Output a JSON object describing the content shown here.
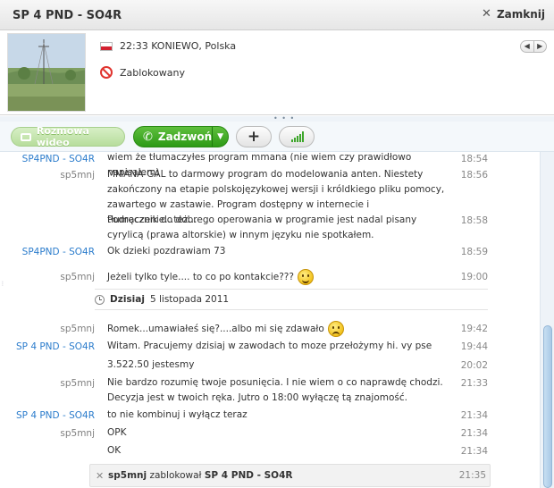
{
  "window": {
    "title": "SP 4 PND - SO4R",
    "close_label": "Zamknij"
  },
  "profile": {
    "local_time_location": "22:33 KONIEWO, Polska",
    "status": "Zablokowany"
  },
  "toolbar": {
    "video_call": "Rozmowa wideo",
    "call": "Zadzwoń"
  },
  "messages": [
    {
      "sender": "",
      "text": "wiem że tłumaczyłes program mmana (nie wiem czy prawidłowo napisałem)",
      "time": ""
    },
    {
      "sender": "SP4PND - SO4R",
      "text": "",
      "time": "18:54"
    },
    {
      "sender": "sp5mnj",
      "text": "MMANA-GAL to darmowy program do modelowania anten. Niestety zakończony na etapie polskojęzykowej wersji i króldkiego pliku pomocy, zawartego w zastawie. Program dostępny w internecie i tłumaczenie...też...",
      "time": "18:56"
    },
    {
      "sender": "",
      "text": "Podręcznik do dobrego operowania w programie jest nadal pisany cyrylicą (prawa altorskie) w innym języku nie spotkałem.",
      "time": "18:58"
    },
    {
      "sender": "SP4PND - SO4R",
      "text": "Ok dzieki pozdrawiam 73",
      "time": "18:59"
    },
    {
      "sender": "sp5mnj",
      "text": "Jeżeli tylko tyle.... to co po kontakcie???",
      "time": "19:00"
    },
    {
      "sender": "sp5mnj",
      "text": "Romek...umawiałeś się?....albo mi się zdawało",
      "time": "19:42"
    },
    {
      "sender": "SP 4 PND - SO4R",
      "text": "Witam. Pracujemy dzisiaj w zawodach to moze przełożymy hi. vy pse",
      "time": "19:44"
    },
    {
      "sender": "",
      "text": "3.522.50 jestesmy",
      "time": "20:02"
    },
    {
      "sender": "sp5mnj",
      "text": "Nie bardzo rozumię twoje posunięcia. I nie wiem o co naprawdę chodzi. Decyzja jest w twoich ręka. Jutro o 18:00 wyłączę tą znajomość.",
      "time": "21:33"
    },
    {
      "sender": "SP 4 PND - SO4R",
      "text": "to nie kombinuj i wyłącz teraz",
      "time": "21:34"
    },
    {
      "sender": "sp5mnj",
      "text": "OPK",
      "time": "21:34"
    },
    {
      "sender": "",
      "text": "OK",
      "time": "21:34"
    }
  ],
  "date_separator": {
    "day": "Dzisiaj",
    "date": "5 listopada 2011"
  },
  "system_message": {
    "actor": "sp5mnj",
    "action": "zablokował",
    "target": "SP 4 PND - SO4R",
    "time": "21:35"
  },
  "colors": {
    "link_blue": "#2b7ccc",
    "call_green": "#2c9a16",
    "signal_green": "#3da62a"
  }
}
